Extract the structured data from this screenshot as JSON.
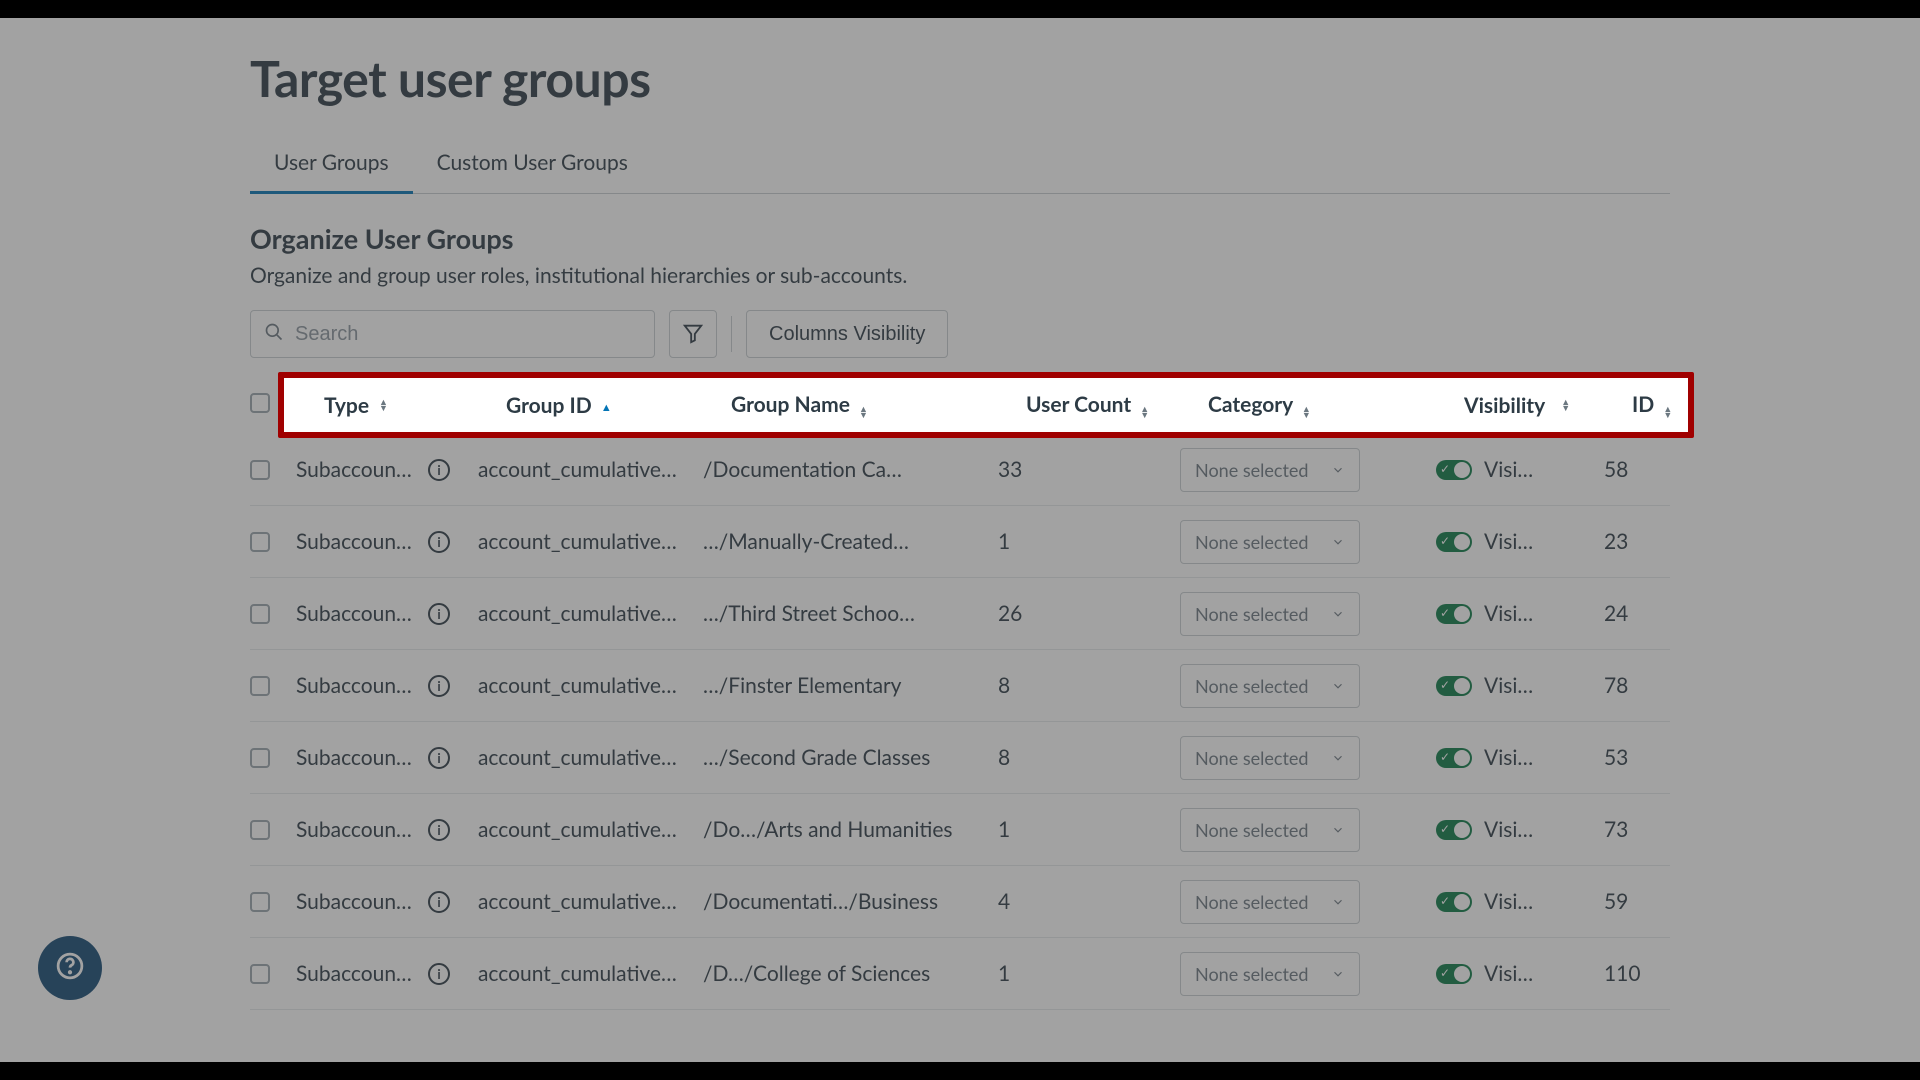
{
  "page": {
    "title": "Target user groups"
  },
  "tabs": [
    {
      "label": "User Groups",
      "active": true
    },
    {
      "label": "Custom User Groups",
      "active": false
    }
  ],
  "section": {
    "title": "Organize User Groups",
    "description": "Organize and group user roles, institutional hierarchies or sub-accounts."
  },
  "toolbar": {
    "search_placeholder": "Search",
    "columns_visibility_label": "Columns Visibility"
  },
  "table": {
    "headers": {
      "type": "Type",
      "group_id": "Group ID",
      "group_name": "Group Name",
      "user_count": "User Count",
      "category": "Category",
      "visibility": "Visibility",
      "id": "ID"
    },
    "sort": {
      "column": "group_id",
      "dir": "asc"
    },
    "category_placeholder": "None selected",
    "visibility_label": "Visible",
    "rows": [
      {
        "type": "Subaccount…",
        "group_id": "account_cumulative…",
        "group_name": "/Documentation Ca…",
        "user_count": "33",
        "id": "58"
      },
      {
        "type": "Subaccount…",
        "group_id": "account_cumulative…",
        "group_name": "…/Manually-Created…",
        "user_count": "1",
        "id": "23"
      },
      {
        "type": "Subaccount…",
        "group_id": "account_cumulative…",
        "group_name": "…/Third Street Schoo…",
        "user_count": "26",
        "id": "24"
      },
      {
        "type": "Subaccount…",
        "group_id": "account_cumulative…",
        "group_name": "…/Finster Elementary",
        "user_count": "8",
        "id": "78"
      },
      {
        "type": "Subaccount…",
        "group_id": "account_cumulative…",
        "group_name": "…/Second Grade Classes",
        "user_count": "8",
        "id": "53"
      },
      {
        "type": "Subaccount…",
        "group_id": "account_cumulative…",
        "group_name": "/Do…/Arts and Humanities",
        "user_count": "1",
        "id": "73"
      },
      {
        "type": "Subaccount…",
        "group_id": "account_cumulative…",
        "group_name": "/Documentati…/Business",
        "user_count": "4",
        "id": "59"
      },
      {
        "type": "Subaccount…",
        "group_id": "account_cumulative…",
        "group_name": "/D…/College of Sciences",
        "user_count": "1",
        "id": "110"
      }
    ]
  }
}
